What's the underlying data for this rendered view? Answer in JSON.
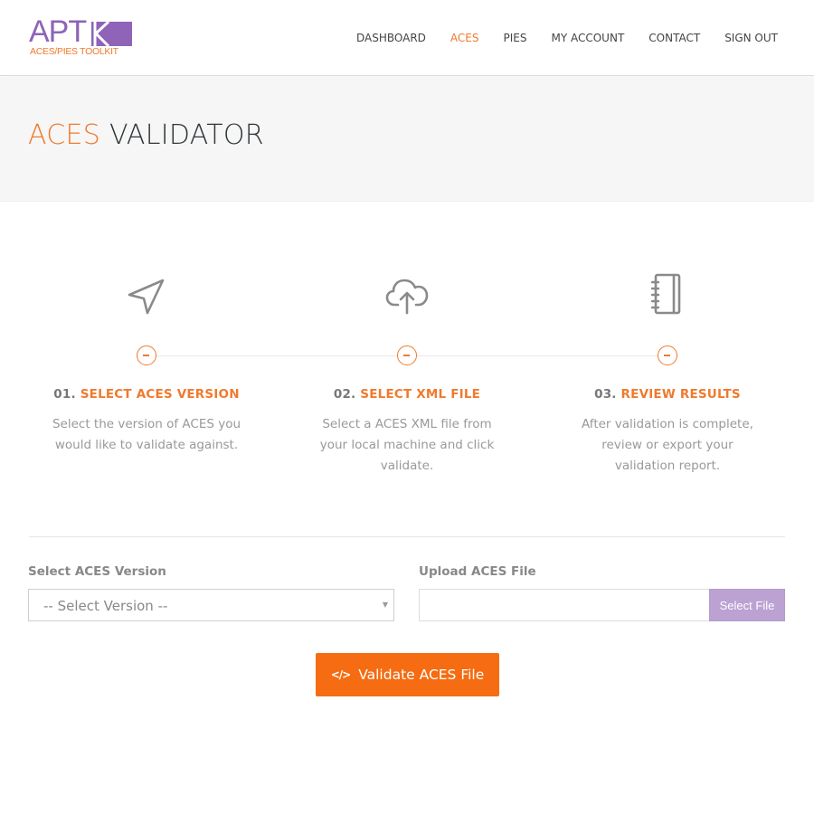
{
  "header": {
    "logo": {
      "main": "APT",
      "subtitle": "ACES/PIES TOOLKIT",
      "brand_purple": "#8e63b8",
      "brand_orange": "#f07a2e"
    },
    "nav": [
      {
        "label": "DASHBOARD",
        "active": false
      },
      {
        "label": "ACES",
        "active": true
      },
      {
        "label": "PIES",
        "active": false
      },
      {
        "label": "MY ACCOUNT",
        "active": false
      },
      {
        "label": "CONTACT",
        "active": false
      },
      {
        "label": "SIGN OUT",
        "active": false
      }
    ]
  },
  "title": {
    "accent": "ACES",
    "rest": "VALIDATOR"
  },
  "steps": [
    {
      "icon": "navigation-arrow-icon",
      "number": "01.",
      "name": "SELECT ACES VERSION",
      "description": "Select the version of ACES you would like to validate against."
    },
    {
      "icon": "cloud-upload-icon",
      "number": "02.",
      "name": "SELECT XML FILE",
      "description": "Select a ACES XML file from your local machine and click validate."
    },
    {
      "icon": "notebook-icon",
      "number": "03.",
      "name": "REVIEW RESULTS",
      "description": "After validation is complete, review or export your validation report."
    }
  ],
  "form": {
    "version_label": "Select ACES Version",
    "version_selected": "-- Select Version --",
    "upload_label": "Upload ACES File",
    "upload_value": "",
    "select_file_label": "Select File",
    "validate_label": "Validate ACES File",
    "validate_icon": "</>",
    "accent_color": "#f56c12",
    "select_file_color": "#bba2d3"
  }
}
